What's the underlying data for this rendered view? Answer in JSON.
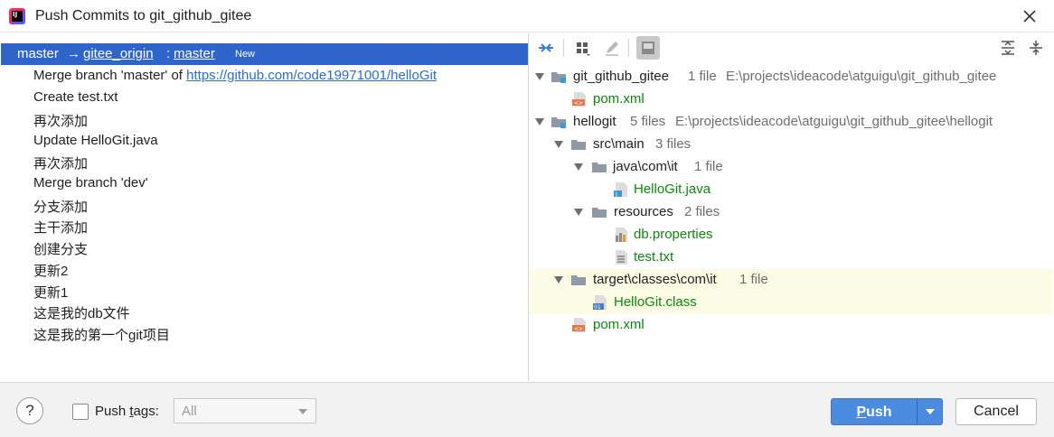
{
  "window": {
    "title": "Push Commits to git_github_gitee"
  },
  "branch_row": {
    "local": "master",
    "arrow": "→",
    "remote": "gitee_origin",
    "colon": ":",
    "remote_branch": "master",
    "badge": "New"
  },
  "commits": [
    {
      "text": "Merge branch 'master' of ",
      "link": "https://github.com/code19971001/helloGit"
    },
    {
      "text": "Create test.txt"
    },
    {
      "text": "再次添加"
    },
    {
      "text": "Update HelloGit.java"
    },
    {
      "text": "再次添加"
    },
    {
      "text": "Merge branch 'dev'"
    },
    {
      "text": "分支添加"
    },
    {
      "text": "主干添加"
    },
    {
      "text": "创建分支"
    },
    {
      "text": "更新2"
    },
    {
      "text": "更新1"
    },
    {
      "text": "这是我的db文件"
    },
    {
      "text": "这是我的第一个git项目"
    }
  ],
  "toolbar": {
    "icons": [
      "merge-arrows-icon",
      "group-by-icon",
      "edit-icon",
      "diff-panel-icon",
      "expand-all-icon",
      "collapse-all-icon"
    ]
  },
  "tree": [
    {
      "name": "git_github_gitee",
      "info": "1 file",
      "path": "E:\\projects\\ideacode\\atguigu\\git_github_gitee"
    },
    {
      "name": "pom.xml"
    },
    {
      "name": "hellogit",
      "info": "5 files",
      "path": "E:\\projects\\ideacode\\atguigu\\git_github_gitee\\hellogit"
    },
    {
      "name": "src\\main",
      "info": "3 files"
    },
    {
      "name": "java\\com\\it",
      "info": "1 file"
    },
    {
      "name": "HelloGit.java"
    },
    {
      "name": "resources",
      "info": "2 files"
    },
    {
      "name": "db.properties"
    },
    {
      "name": "test.txt"
    },
    {
      "name": "target\\classes\\com\\it",
      "info": "1 file"
    },
    {
      "name": "HelloGit.class"
    },
    {
      "name": "pom.xml"
    }
  ],
  "footer": {
    "help": "?",
    "push_tags_label_before": "Push ",
    "push_tags_mnemonic": "t",
    "push_tags_label_after": "ags:",
    "tags_select": "All",
    "push_label_mnemonic": "P",
    "push_label_rest": "ush",
    "cancel": "Cancel"
  },
  "colors": {
    "selection": "#2f65ca",
    "accent": "#4b8be0",
    "file_modified": "#0b8a0b",
    "highlight_row": "#fcfce6"
  }
}
